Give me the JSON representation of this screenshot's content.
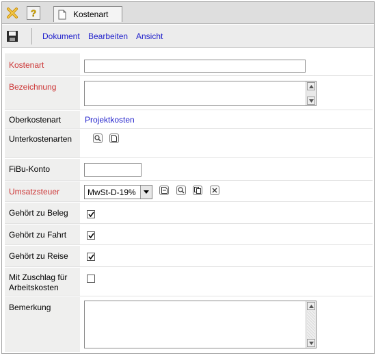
{
  "header": {
    "tab_label": "Kostenart"
  },
  "toolbar": {
    "close_icon": "close-icon",
    "help_icon": "help-icon"
  },
  "menu": {
    "items": [
      "Dokument",
      "Bearbeiten",
      "Ansicht"
    ]
  },
  "form": {
    "kostenart": {
      "label": "Kostenart",
      "value": ""
    },
    "bezeichnung": {
      "label": "Bezeichnung",
      "value": ""
    },
    "oberkostenart": {
      "label": "Oberkostenart",
      "value": "Projektkosten"
    },
    "unterkostenarten": {
      "label": "Unterkostenarten"
    },
    "fibu": {
      "label": "FiBu-Konto",
      "value": ""
    },
    "umsatzsteuer": {
      "label": "Umsatzsteuer",
      "value": "MwSt-D-19%"
    },
    "beleg": {
      "label": "Gehört zu Beleg",
      "checked": true
    },
    "fahrt": {
      "label": "Gehört zu Fahrt",
      "checked": true
    },
    "reise": {
      "label": "Gehört zu Reise",
      "checked": true
    },
    "zuschlag": {
      "label_line1": "Mit Zuschlag für",
      "label_line2": "Arbeitskosten",
      "checked": false
    },
    "bemerkung": {
      "label": "Bemerkung",
      "value": ""
    }
  },
  "colors": {
    "required_label": "#cc3333",
    "link": "#2222cc"
  }
}
